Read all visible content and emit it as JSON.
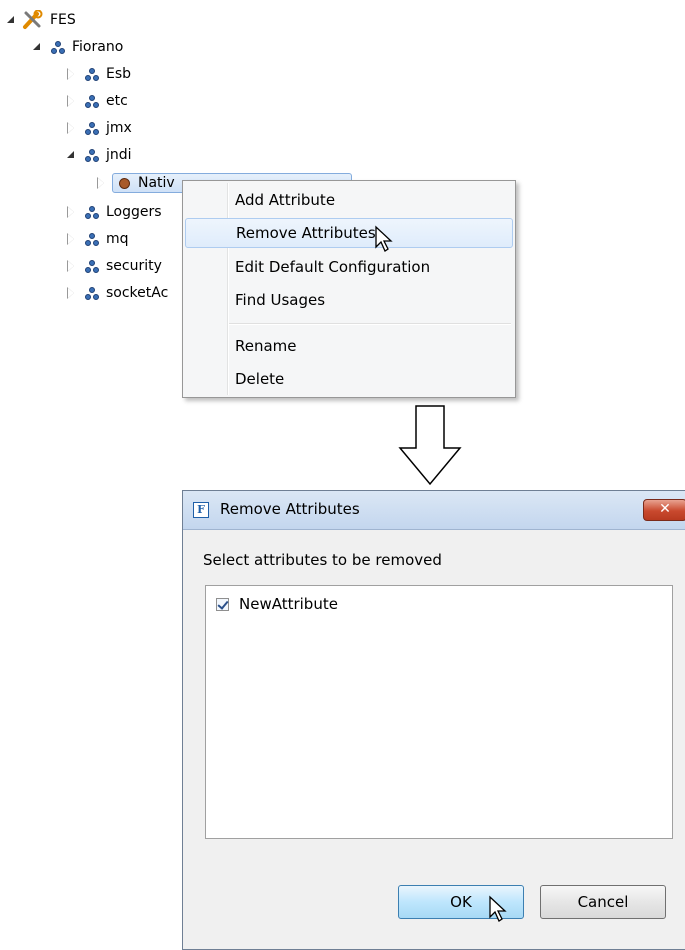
{
  "tree": {
    "root": "FES",
    "items": [
      {
        "label": "Fiorano",
        "level": 1,
        "state": "open"
      },
      {
        "label": "Esb",
        "level": 2,
        "state": "closed"
      },
      {
        "label": "etc",
        "level": 2,
        "state": "closed"
      },
      {
        "label": "jmx",
        "level": 2,
        "state": "closed"
      },
      {
        "label": "jndi",
        "level": 2,
        "state": "open"
      },
      {
        "label": "NativeFileNamingManager",
        "level": 3,
        "state": "closed",
        "visible_text": "Nativ"
      },
      {
        "label": "Loggers",
        "level": 2,
        "state": "closed"
      },
      {
        "label": "mq",
        "level": 2,
        "state": "closed"
      },
      {
        "label": "security",
        "level": 2,
        "state": "closed"
      },
      {
        "label": "socketAc",
        "level": 2,
        "state": "closed"
      }
    ]
  },
  "context_menu": {
    "items": [
      "Add Attribute",
      "Remove Attributes",
      "Edit Default Configuration",
      "Find Usages",
      "Rename",
      "Delete"
    ],
    "highlighted": "Remove Attributes"
  },
  "dialog": {
    "title": "Remove Attributes",
    "app_icon": "F",
    "close_symbol": "✕",
    "prompt": "Select attributes to be removed",
    "attributes": [
      {
        "label": "NewAttribute",
        "checked": true
      }
    ],
    "ok_label": "OK",
    "cancel_label": "Cancel"
  },
  "colors": {
    "node_icon": "#3a6fb5",
    "menu_highlight": "#dfecfb",
    "close_button": "#c9492e",
    "ok_button": "#bee6fd"
  }
}
